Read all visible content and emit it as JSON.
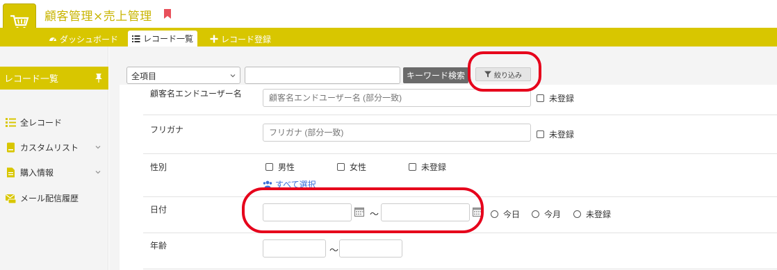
{
  "app": {
    "title": "顧客管理×売上管理"
  },
  "nav": {
    "dashboard": "ダッシュボード",
    "record_list": "レコード一覧",
    "record_add": "レコード登録"
  },
  "sidebar": {
    "heading": "レコード一覧",
    "items": [
      {
        "label": "全レコード",
        "icon": "list-icon"
      },
      {
        "label": "カスタムリスト",
        "icon": "document-icon"
      },
      {
        "label": "購入情報",
        "icon": "file-icon"
      },
      {
        "label": "メール配信履歴",
        "icon": "mail-history-icon"
      }
    ]
  },
  "search": {
    "scope_value": "全項目",
    "keyword_value": "",
    "keyword_button": "キーワード検索",
    "filter_button": "絞り込み"
  },
  "form": {
    "name_row": {
      "label": "顧客名エンドユーザー名",
      "placeholder": "顧客名エンドユーザー名 (部分一致)",
      "unregistered": "未登録"
    },
    "kana_row": {
      "label": "フリガナ",
      "placeholder": "フリガナ (部分一致)",
      "unregistered": "未登録"
    },
    "gender_row": {
      "label": "性別",
      "options": [
        "男性",
        "女性",
        "未登録"
      ],
      "select_all": "すべて選択"
    },
    "date_row": {
      "label": "日付",
      "from": "",
      "to": "",
      "tilde": "～",
      "today": "今日",
      "this_month": "今月",
      "unregistered": "未登録"
    },
    "age_row": {
      "label": "年齢",
      "from": "",
      "to": "",
      "tilde": "～"
    }
  },
  "colors": {
    "accent": "#d8c600",
    "highlight": "#e6001b",
    "link": "#3a6fd8"
  }
}
